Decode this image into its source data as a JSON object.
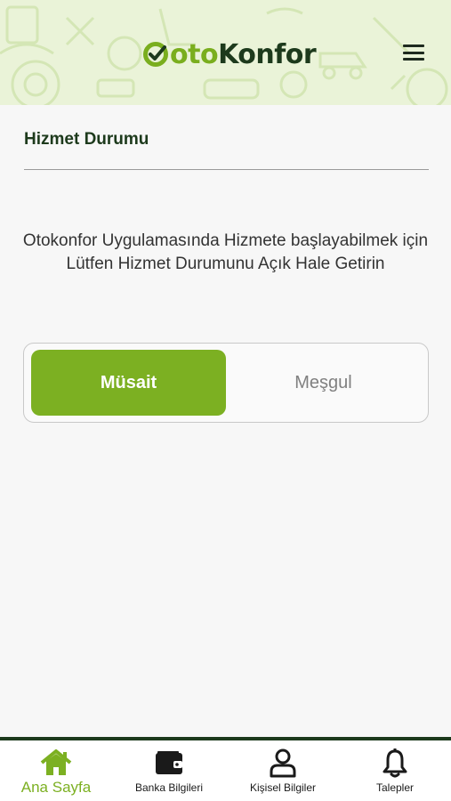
{
  "header": {
    "logo_part1": "oto",
    "logo_part2": "Konfor",
    "menu_icon": "hamburger-icon"
  },
  "page": {
    "title": "Hizmet Durumu",
    "info_text": "Otokonfor Uygulamasında Hizmete başlayabilmek için Lütfen Hizmet Durumunu Açık Hale Getirin"
  },
  "status_toggle": {
    "options": [
      {
        "label": "Müsait",
        "selected": true
      },
      {
        "label": "Meşgul",
        "selected": false
      }
    ]
  },
  "bottom_nav": {
    "items": [
      {
        "label": "Ana Sayfa",
        "icon": "home-icon",
        "active": true
      },
      {
        "label": "Banka Bilgileri",
        "icon": "wallet-icon",
        "active": false
      },
      {
        "label": "Kişisel Bilgiler",
        "icon": "user-icon",
        "active": false
      },
      {
        "label": "Talepler",
        "icon": "bell-icon",
        "active": false
      }
    ]
  },
  "colors": {
    "accent": "#7cb022",
    "dark_green": "#1d3a1c",
    "header_bg": "#eaf3d8"
  }
}
